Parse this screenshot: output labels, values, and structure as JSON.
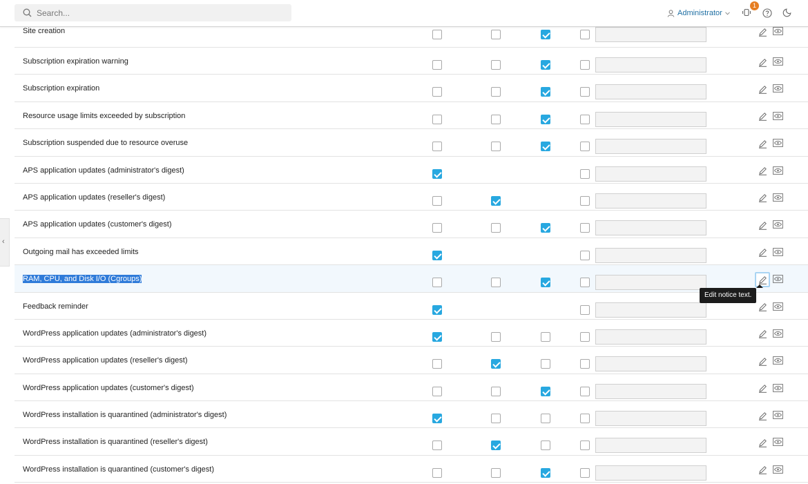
{
  "topbar": {
    "search_placeholder": "Search...",
    "admin_label": "Administrator",
    "notifications_count": "1"
  },
  "tooltip": "Edit notice text.",
  "rows": [
    {
      "label": "Site creation",
      "checks": [
        false,
        false,
        true,
        false
      ]
    },
    {
      "label": "Subscription expiration warning",
      "checks": [
        false,
        false,
        true,
        false
      ]
    },
    {
      "label": "Subscription expiration",
      "checks": [
        false,
        false,
        true,
        false
      ]
    },
    {
      "label": "Resource usage limits exceeded by subscription",
      "checks": [
        false,
        false,
        true,
        false
      ]
    },
    {
      "label": "Subscription suspended due to resource overuse",
      "checks": [
        false,
        false,
        true,
        false
      ]
    },
    {
      "label": "APS application updates (administrator's digest)",
      "checks": [
        true,
        null,
        null,
        false
      ]
    },
    {
      "label": "APS application updates (reseller's digest)",
      "checks": [
        false,
        true,
        null,
        false
      ]
    },
    {
      "label": "APS application updates (customer's digest)",
      "checks": [
        false,
        false,
        true,
        false
      ]
    },
    {
      "label": "Outgoing mail has exceeded limits",
      "checks": [
        true,
        null,
        null,
        false
      ]
    },
    {
      "label": "RAM, CPU, and Disk I/O (Cgroups)",
      "checks": [
        false,
        false,
        true,
        false
      ]
    },
    {
      "label": "Feedback reminder",
      "checks": [
        true,
        null,
        null,
        false
      ]
    },
    {
      "label": "WordPress application updates (administrator's digest)",
      "checks": [
        true,
        false,
        false,
        false
      ]
    },
    {
      "label": "WordPress application updates (reseller's digest)",
      "checks": [
        false,
        true,
        false,
        false
      ]
    },
    {
      "label": "WordPress application updates (customer's digest)",
      "checks": [
        false,
        false,
        true,
        false
      ]
    },
    {
      "label": "WordPress installation is quarantined (administrator's digest)",
      "checks": [
        true,
        false,
        false,
        false
      ]
    },
    {
      "label": "WordPress installation is quarantined (reseller's digest)",
      "checks": [
        false,
        true,
        false,
        false
      ]
    },
    {
      "label": "WordPress installation is quarantined (customer's digest)",
      "checks": [
        false,
        false,
        true,
        false
      ]
    }
  ],
  "selected_row": 9,
  "colors": {
    "accent": "#28a8e0",
    "link": "#1f6fa3",
    "badge": "#e67e22"
  }
}
